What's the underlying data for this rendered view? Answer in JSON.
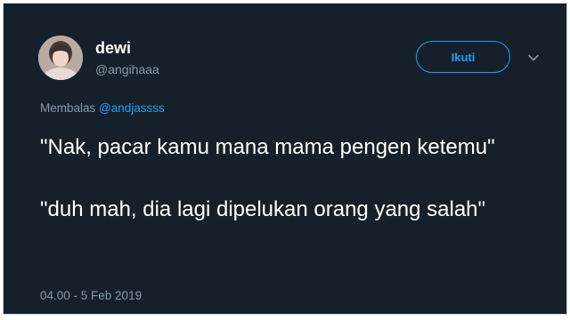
{
  "tweet": {
    "author": {
      "display_name": "dewi",
      "handle": "@angihaaa"
    },
    "follow_button_label": "Ikuti",
    "reply_prefix": "Membalas",
    "reply_to": "@andjassss",
    "paragraphs": [
      "\"Nak, pacar kamu mana mama pengen ketemu\"",
      "\"duh mah, dia lagi dipelukan orang yang salah\""
    ],
    "timestamp": "04.00 - 5 Feb 2019"
  },
  "icons": {
    "menu": "chevron-down-icon"
  },
  "colors": {
    "background": "#15202b",
    "accent": "#1da1f2",
    "secondary_text": "#8899a6",
    "primary_text": "#ffffff"
  }
}
